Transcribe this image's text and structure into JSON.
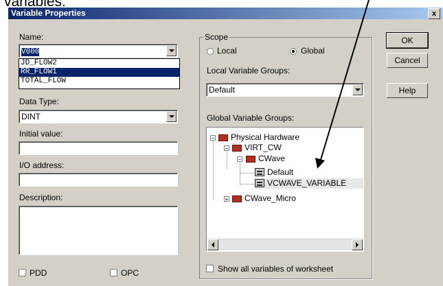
{
  "caption": "variables:",
  "window": {
    "title": "Variable Properties",
    "close": "x"
  },
  "name": {
    "label": "Name:",
    "value": "V000"
  },
  "name_list": [
    "JD_FLOW2",
    "RR_FLOW1",
    "TOTAL_FLOW"
  ],
  "data_type": {
    "label": "Data Type:",
    "value": "DINT"
  },
  "initial_value": {
    "label": "Initial value:",
    "value": ""
  },
  "io_address": {
    "label": "I/O address:",
    "value": ""
  },
  "description": {
    "label": "Description:",
    "value": ""
  },
  "checkboxes": {
    "pdd": "PDD",
    "opc": "OPC"
  },
  "scope": {
    "title": "Scope",
    "local": "Local",
    "global": "Global",
    "selected": "Global",
    "local_groups_label": "Local Variable Groups:",
    "local_groups_value": "Default",
    "global_groups_label": "Global Variable Groups:",
    "show_all": "Show all variables of worksheet"
  },
  "tree": {
    "physical_hardware": "Physical Hardware",
    "virt_cw": "VIRT_CW",
    "cwave": "CWave",
    "default": "Default",
    "vcwave": "VCWAVE_VARIABLE",
    "cwave_micro": "CWave_Micro"
  },
  "buttons": {
    "ok": "OK",
    "cancel": "Cancel",
    "help": "Help"
  }
}
